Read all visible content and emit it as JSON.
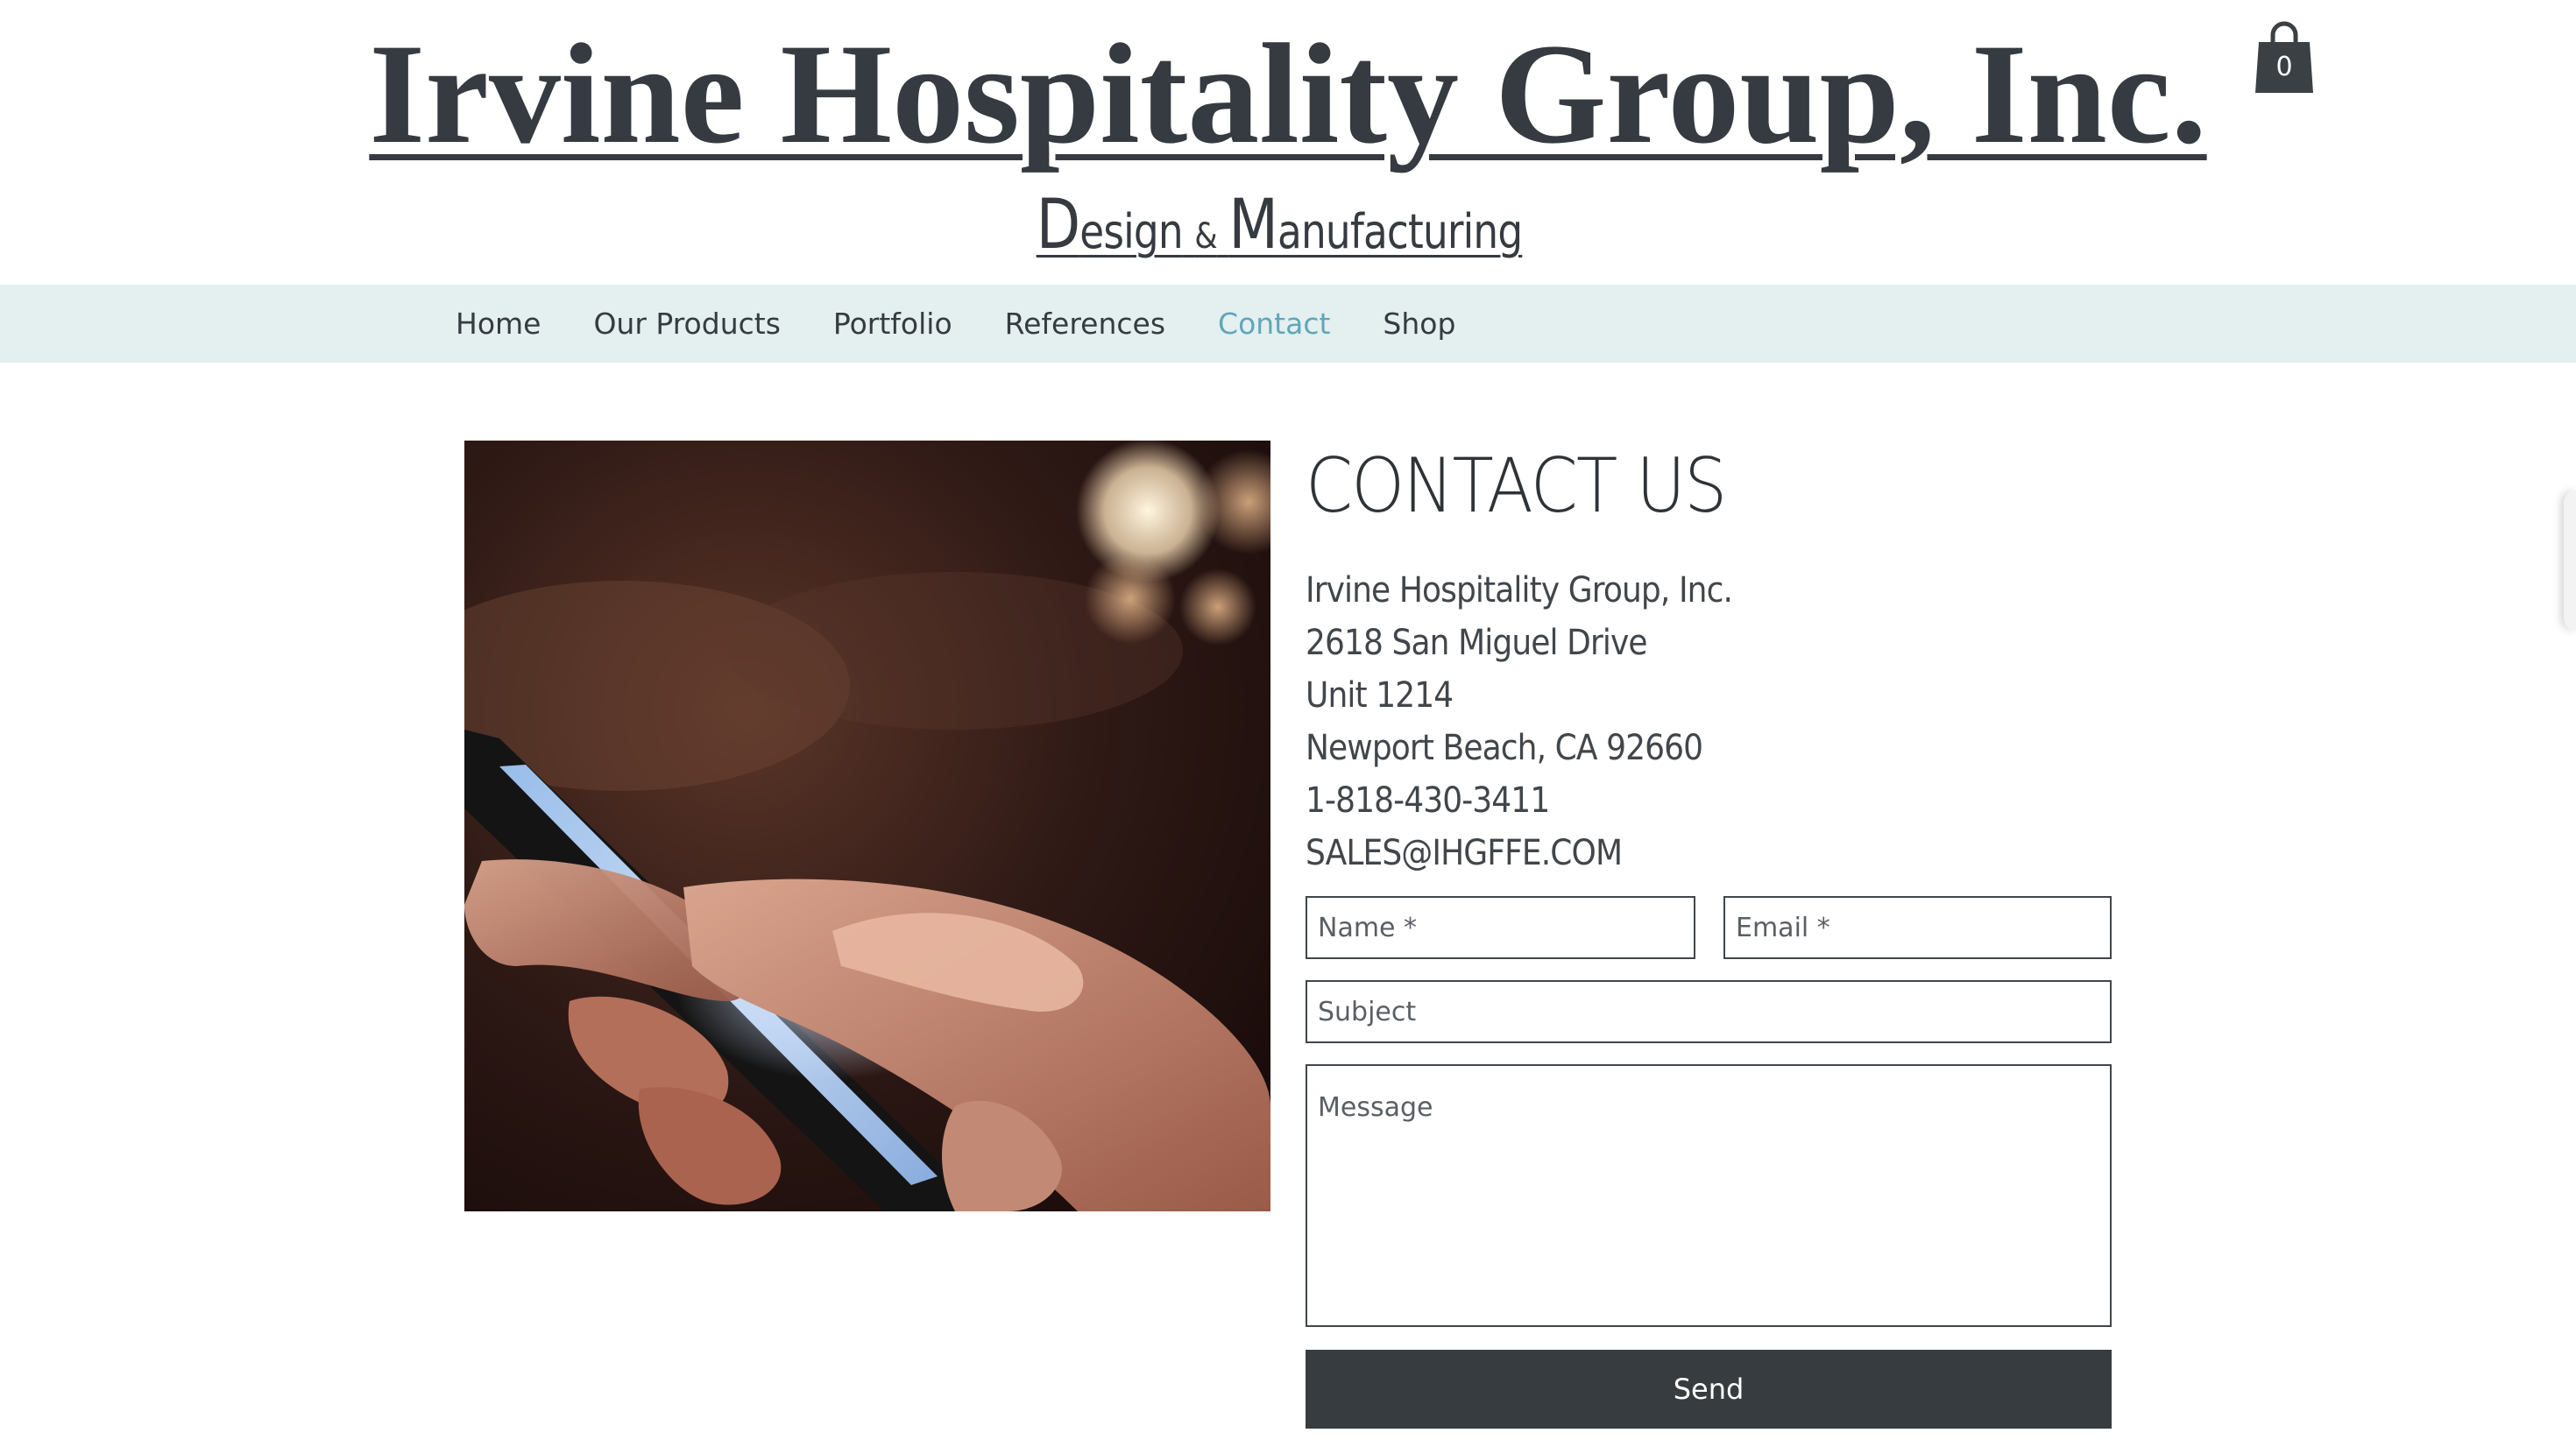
{
  "header": {
    "title": "Irvine Hospitality Group, Inc.",
    "tagline": {
      "part1_initial": "D",
      "part1_rest": "esign",
      "amp": "&",
      "part2_initial": "M",
      "part2_rest": "anufacturing"
    },
    "cart": {
      "icon": "shopping-bag-icon",
      "count": "0"
    }
  },
  "nav": {
    "items": [
      {
        "label": "Home"
      },
      {
        "label": "Our Products"
      },
      {
        "label": "Portfolio"
      },
      {
        "label": "References"
      },
      {
        "label": "Contact"
      },
      {
        "label": "Shop"
      }
    ],
    "active": "Contact",
    "active_color": "#5fa7b8",
    "bar_color": "#e4eff0"
  },
  "contact": {
    "heading": "CONTACT US",
    "address_lines": [
      "Irvine Hospitality Group, Inc.",
      "2618 San Miguel Drive",
      "Unit 1214",
      "Newport Beach, CA 92660",
      "1-818-430-3411",
      "SALES@IHGFFE.COM"
    ]
  },
  "form": {
    "name_placeholder": "Name *",
    "email_placeholder": "Email *",
    "subject_placeholder": "Subject",
    "message_placeholder": "Message",
    "send_label": "Send",
    "button_color": "#373c41"
  }
}
